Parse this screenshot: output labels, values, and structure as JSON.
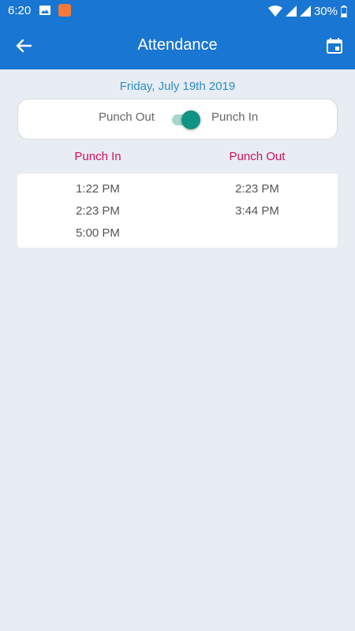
{
  "status_bar": {
    "time": "6:20",
    "battery": "30%"
  },
  "app_bar": {
    "title": "Attendance"
  },
  "date": "Friday, July 19th 2019",
  "toggle": {
    "off_label": "Punch Out",
    "on_label": "Punch In",
    "state": "on"
  },
  "columns": {
    "punch_in_header": "Punch In",
    "punch_out_header": "Punch Out"
  },
  "punch_in_times": [
    "1:22 PM",
    "2:23 PM",
    "5:00 PM"
  ],
  "punch_out_times": [
    "2:23 PM",
    "3:44 PM"
  ],
  "colors": {
    "primary": "#1976d2",
    "date_text": "#2a8fc4",
    "column_header": "#d0105a",
    "toggle_thumb": "#0f9384",
    "toggle_track": "#a6d6cf",
    "background": "#e8ecf3"
  }
}
